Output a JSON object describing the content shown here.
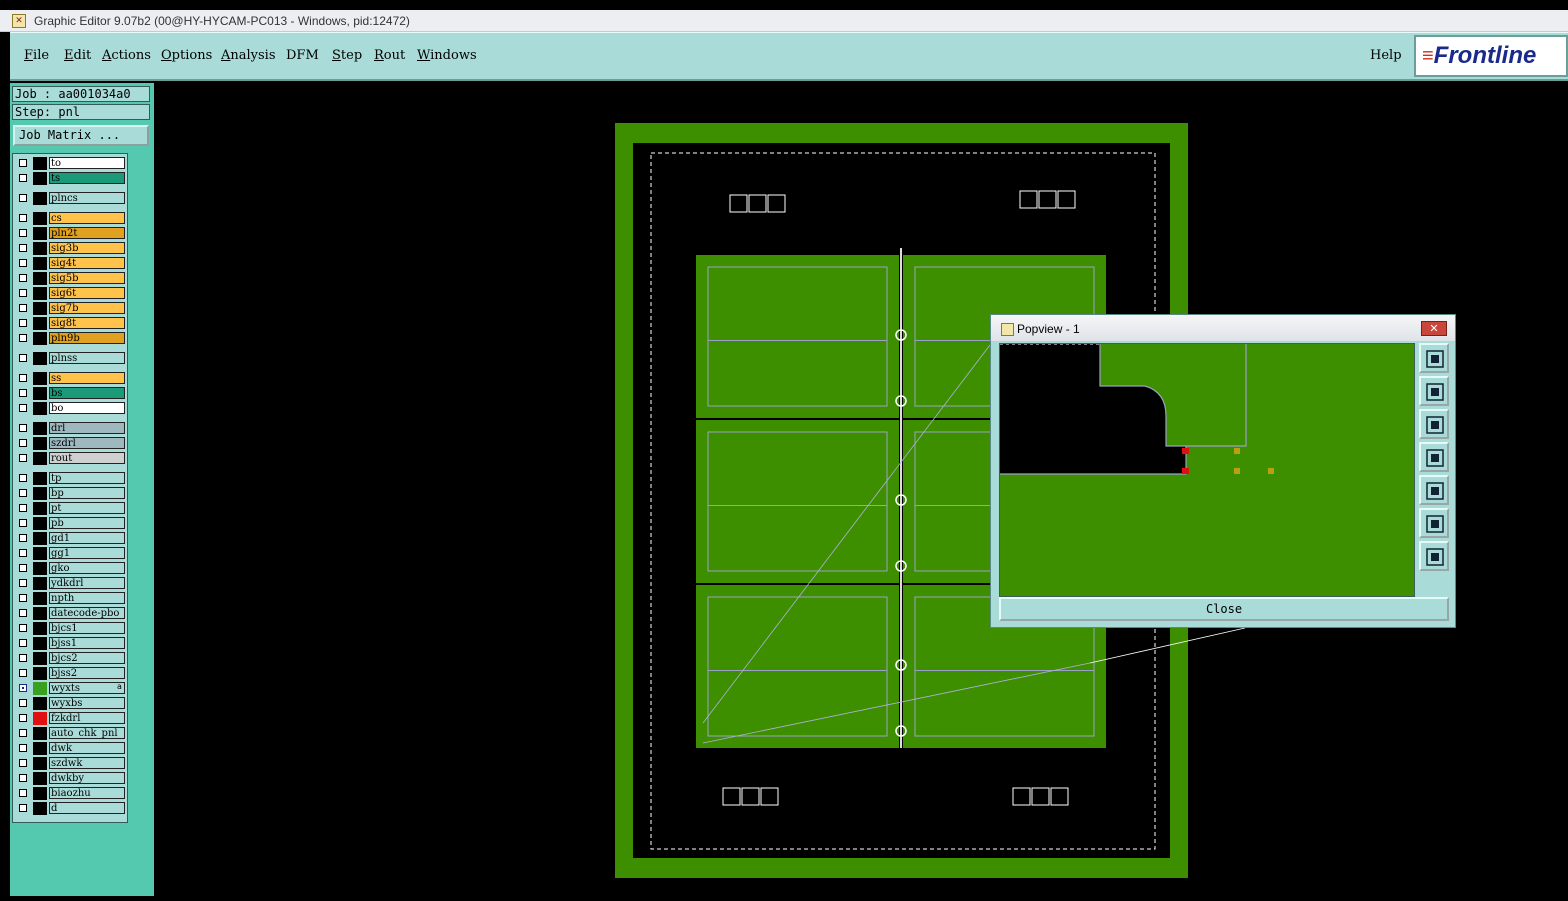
{
  "window": {
    "title": "Graphic Editor 9.07b2 (00@HY-HYCAM-PC013 - Windows, pid:12472)"
  },
  "menu": {
    "items": [
      {
        "label": "File",
        "accel": "F",
        "rest": "ile"
      },
      {
        "label": "Edit",
        "accel": "E",
        "rest": "dit"
      },
      {
        "label": "Actions",
        "accel": "A",
        "rest": "ctions"
      },
      {
        "label": "Options",
        "accel": "O",
        "rest": "ptions"
      },
      {
        "label": "Analysis",
        "accel": "A",
        "rest": "nalysis"
      },
      {
        "label": "DFM",
        "accel": "",
        "rest": "DFM"
      },
      {
        "label": "Step",
        "accel": "S",
        "rest": "tep"
      },
      {
        "label": "Rout",
        "accel": "R",
        "rest": "out"
      },
      {
        "label": "Windows",
        "accel": "W",
        "rest": "indows"
      }
    ],
    "help": "Help",
    "logo": "Frontline"
  },
  "job": {
    "job_line": "Job : aa001034a0",
    "step_line": "Step: pnl",
    "matrix_button": "Job Matrix ..."
  },
  "layers": [
    {
      "name": "to",
      "color": "#ffffff"
    },
    {
      "name": "ts",
      "color": "#1a9a78"
    },
    {
      "name": "plncs",
      "color": "#a9dcd8"
    },
    {
      "name": "cs",
      "color": "#ffc24a"
    },
    {
      "name": "pln2t",
      "color": "#e0a020"
    },
    {
      "name": "sig3b",
      "color": "#ffc24a"
    },
    {
      "name": "sig4t",
      "color": "#ffc24a"
    },
    {
      "name": "sig5b",
      "color": "#ffc24a"
    },
    {
      "name": "sig6t",
      "color": "#ffc24a"
    },
    {
      "name": "sig7b",
      "color": "#ffc24a"
    },
    {
      "name": "sig8t",
      "color": "#ffc24a"
    },
    {
      "name": "pln9b",
      "color": "#e0a020"
    },
    {
      "name": "plnss",
      "color": "#a9dcd8"
    },
    {
      "name": "ss",
      "color": "#ffc24a"
    },
    {
      "name": "bs",
      "color": "#1a9a78"
    },
    {
      "name": "bo",
      "color": "#ffffff"
    },
    {
      "name": "drl",
      "color": "#9fb8c0"
    },
    {
      "name": "szdrl",
      "color": "#9fb8c0"
    },
    {
      "name": "rout",
      "color": "#d0d0d0"
    },
    {
      "name": "tp",
      "color": "#a9dcd8"
    },
    {
      "name": "bp",
      "color": "#a9dcd8"
    },
    {
      "name": "pt",
      "color": "#a9dcd8"
    },
    {
      "name": "pb",
      "color": "#a9dcd8"
    },
    {
      "name": "gd1",
      "color": "#a9dcd8"
    },
    {
      "name": "gg1",
      "color": "#a9dcd8"
    },
    {
      "name": "gko",
      "color": "#a9dcd8"
    },
    {
      "name": "ydkdrl",
      "color": "#a9dcd8"
    },
    {
      "name": "npth",
      "color": "#a9dcd8"
    },
    {
      "name": "datecode-pbo",
      "color": "#a9dcd8"
    },
    {
      "name": "bjcs1",
      "color": "#a9dcd8"
    },
    {
      "name": "bjss1",
      "color": "#a9dcd8"
    },
    {
      "name": "bjcs2",
      "color": "#a9dcd8"
    },
    {
      "name": "bjss2",
      "color": "#a9dcd8"
    },
    {
      "name": "wyxts",
      "color": "#a9dcd8",
      "checked": true,
      "chip": "#3aa020",
      "flag": "a"
    },
    {
      "name": "wyxbs",
      "color": "#a9dcd8"
    },
    {
      "name": "fzkdrl",
      "color": "#a9dcd8",
      "chip": "#e01010"
    },
    {
      "name": "auto_chk_pnl",
      "color": "#a9dcd8"
    },
    {
      "name": "dwk",
      "color": "#a9dcd8"
    },
    {
      "name": "szdwk",
      "color": "#a9dcd8"
    },
    {
      "name": "dwkby",
      "color": "#a9dcd8"
    },
    {
      "name": "biaozhu",
      "color": "#a9dcd8"
    },
    {
      "name": "d",
      "color": "#a9dcd8"
    }
  ],
  "popview": {
    "title": "Popview - 1",
    "close_label": "Close"
  },
  "colors": {
    "board": "#3d8f00",
    "panel_bg": "#55c9b0",
    "ui": "#a9dcd8"
  }
}
